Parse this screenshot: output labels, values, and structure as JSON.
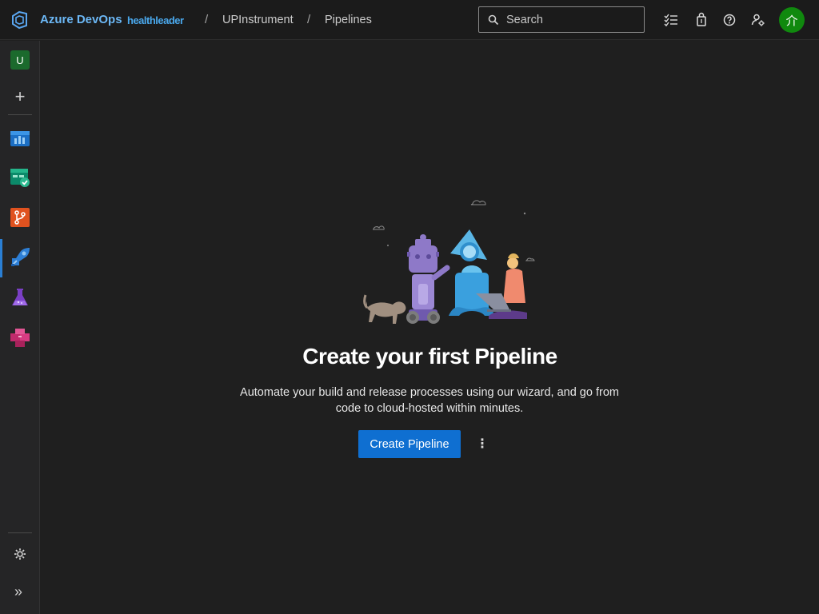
{
  "header": {
    "brand": "Azure DevOps",
    "org": "healthleader",
    "breadcrumb_sep": "/",
    "project": "UPInstrument",
    "section": "Pipelines",
    "search_placeholder": "Search",
    "avatar_initials": "介",
    "icons": [
      "logo-icon",
      "search-icon",
      "work-items-icon",
      "marketplace-bag-icon",
      "help-icon",
      "user-settings-icon"
    ]
  },
  "leftnav": {
    "org_initial": "U",
    "add_label": "+",
    "items": [
      "overview-icon",
      "boards-icon",
      "repos-icon",
      "pipelines-icon",
      "test-plans-icon",
      "artifacts-icon"
    ],
    "active": "pipelines-icon",
    "bottom": [
      "project-settings-icon",
      "expand-icon"
    ],
    "expand_glyph": "»"
  },
  "main": {
    "title": "Create your first Pipeline",
    "description": "Automate your build and release processes using our wizard, and go from code to cloud-hosted within minutes.",
    "create_button": "Create Pipeline",
    "more_glyph": "⋮"
  },
  "colors": {
    "brand": "#6cb8f6",
    "primary_button": "#0f6fd1",
    "avatar": "#10890e",
    "background": "#1f1f1f"
  }
}
